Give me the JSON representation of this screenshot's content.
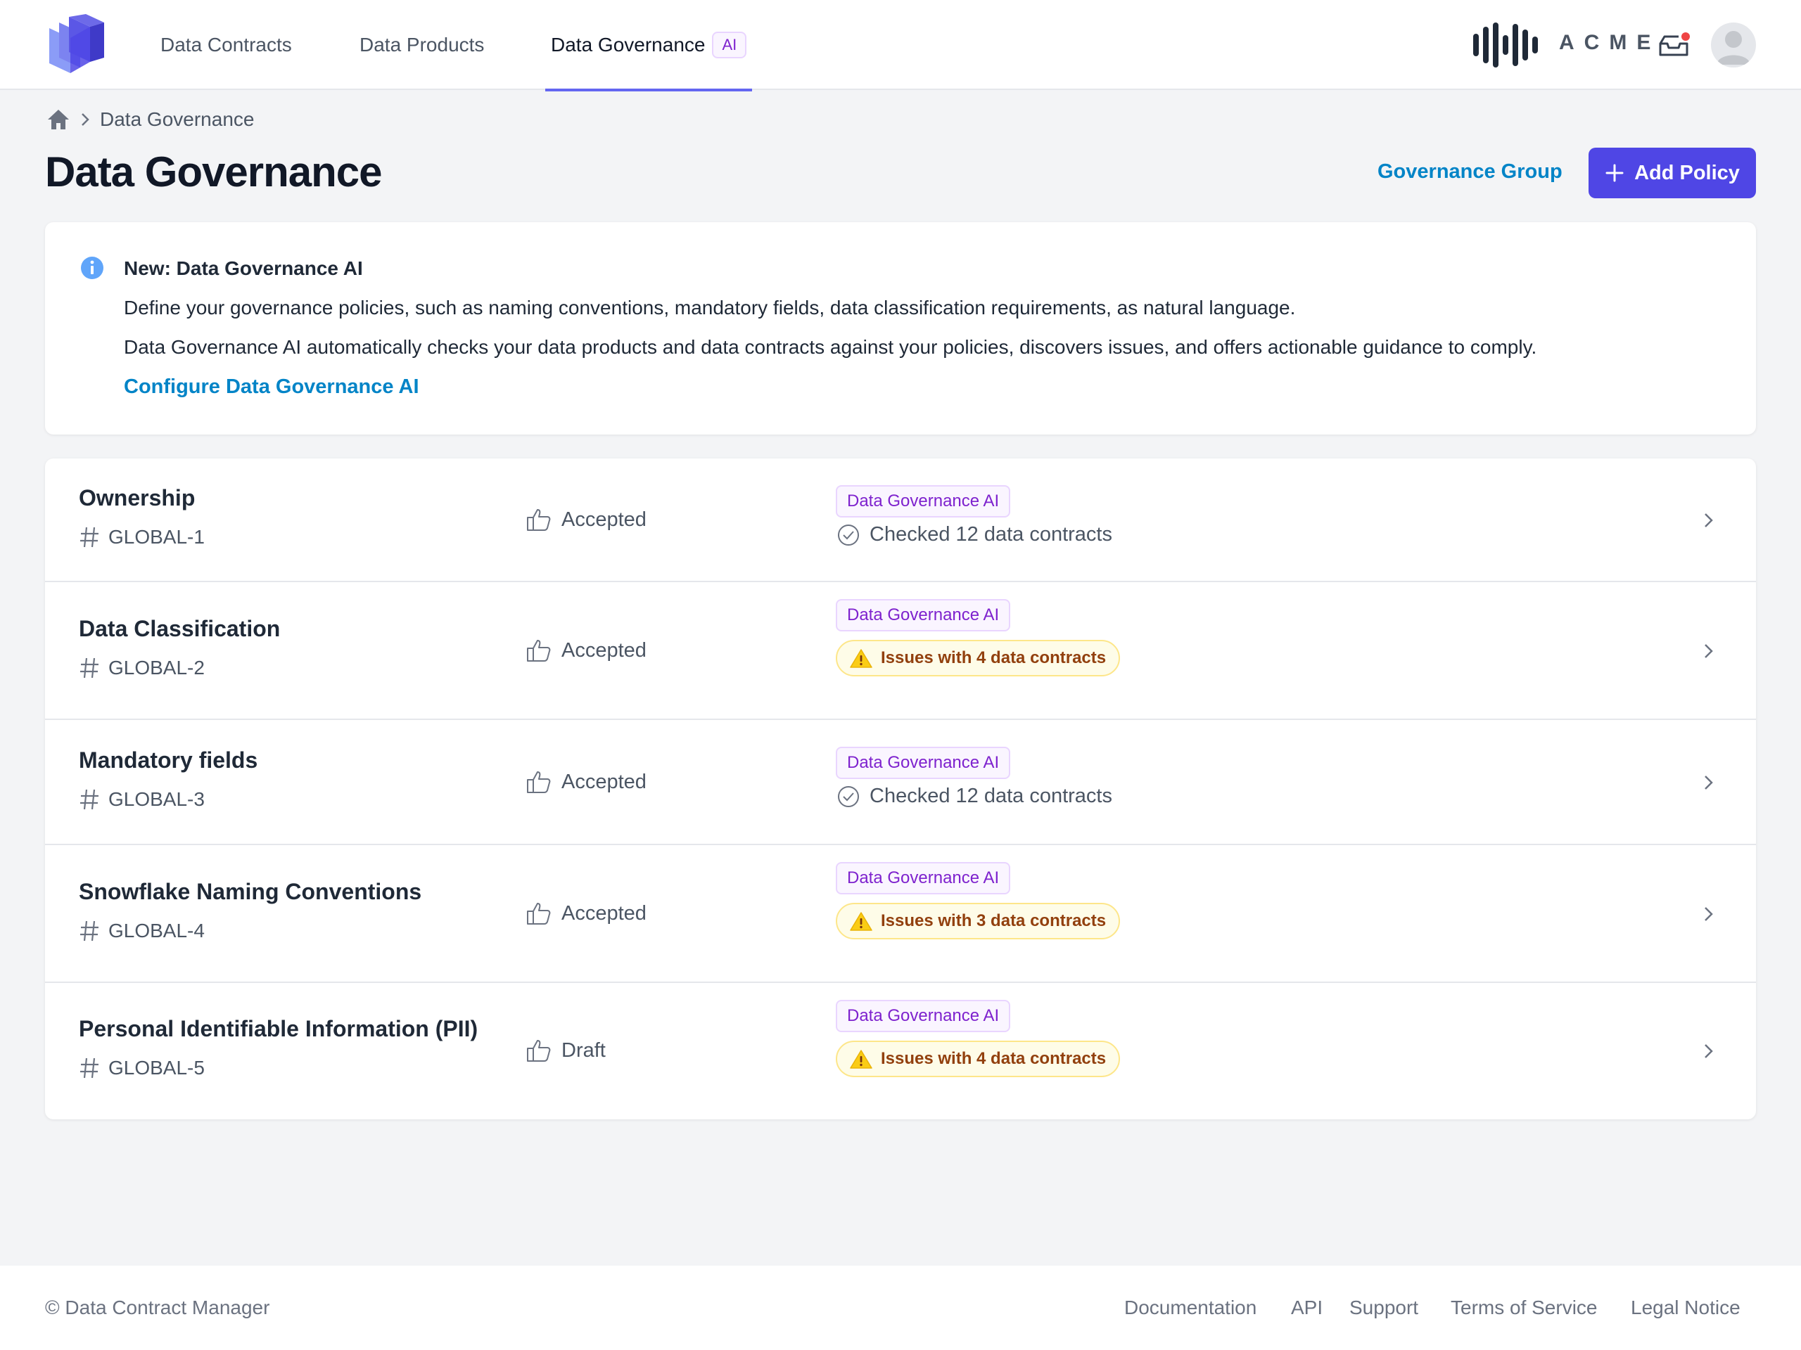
{
  "nav": {
    "tabs": [
      {
        "label": "Data Contracts"
      },
      {
        "label": "Data Products"
      },
      {
        "label": "Data Governance",
        "badge": "AI",
        "active": true
      }
    ],
    "org_logo_text": "ACME",
    "icons": [
      "cube-logo-icon",
      "acme-logo-icon",
      "inbox-icon",
      "avatar-icon"
    ],
    "accent_color": "#6366f1"
  },
  "breadcrumb": {
    "home_icon": "home-icon",
    "current": "Data Governance"
  },
  "page": {
    "title": "Data Governance",
    "governance_group_label": "Governance Group",
    "add_policy_label": "Add Policy"
  },
  "info": {
    "icon": "info-icon",
    "title": "New: Data Governance AI",
    "line1": "Define your governance policies, such as naming conventions, mandatory fields, data classification requirements, as natural language.",
    "line2": "Data Governance AI automatically checks your data products and data contracts against your policies, discovers issues, and offers actionable guidance to comply.",
    "link": "Configure Data Governance AI"
  },
  "policies": [
    {
      "name": "Ownership",
      "id": "GLOBAL-1",
      "status": "Accepted",
      "ai_label": "Data Governance AI",
      "result_type": "checked",
      "result": "Checked 12 data contracts"
    },
    {
      "name": "Data Classification",
      "id": "GLOBAL-2",
      "status": "Accepted",
      "ai_label": "Data Governance AI",
      "result_type": "issues",
      "result": "Issues with 4 data contracts"
    },
    {
      "name": "Mandatory fields",
      "id": "GLOBAL-3",
      "status": "Accepted",
      "ai_label": "Data Governance AI",
      "result_type": "checked",
      "result": "Checked 12 data contracts"
    },
    {
      "name": "Snowflake Naming Conventions",
      "id": "GLOBAL-4",
      "status": "Accepted",
      "ai_label": "Data Governance AI",
      "result_type": "issues",
      "result": "Issues with 3 data contracts"
    },
    {
      "name": "Personal Identifiable Information (PII)",
      "id": "GLOBAL-5",
      "status": "Draft",
      "ai_label": "Data Governance AI",
      "result_type": "issues",
      "result": "Issues with 4 data contracts"
    }
  ],
  "footer": {
    "copyright": "© Data Contract Manager",
    "links": [
      "Documentation",
      "API",
      "Support",
      "Terms of Service",
      "Legal Notice"
    ]
  }
}
